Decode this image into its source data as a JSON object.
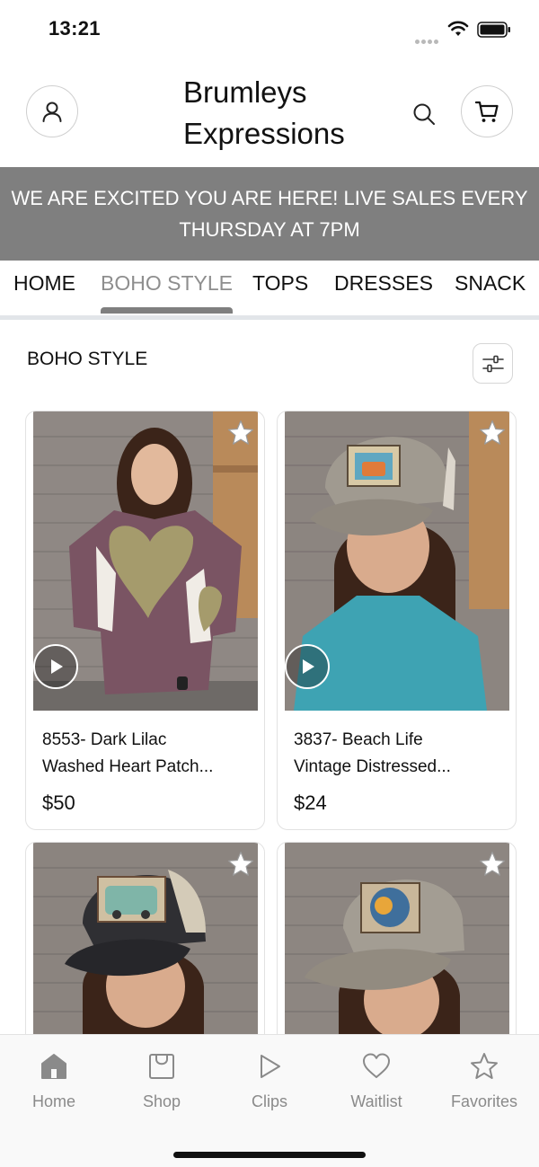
{
  "status_bar": {
    "time": "13:21"
  },
  "header": {
    "store_name": "Brumleys Expressions"
  },
  "banner": {
    "text": "WE ARE EXCITED YOU ARE HERE! LIVE SALES EVERY THURSDAY AT 7PM"
  },
  "categories": [
    {
      "label": "HOME",
      "active": false
    },
    {
      "label": "BOHO STYLE",
      "active": true
    },
    {
      "label": "TOPS",
      "active": false
    },
    {
      "label": "DRESSES",
      "active": false
    },
    {
      "label": "SNACK",
      "active": false
    }
  ],
  "section": {
    "title": "BOHO STYLE"
  },
  "products": [
    {
      "name_line1": "8553- Dark Lilac",
      "name_line2": "Washed Heart Patch...",
      "price": "$50",
      "has_video": true
    },
    {
      "name_line1": "3837- Beach Life",
      "name_line2": "Vintage Distressed...",
      "price": "$24",
      "has_video": true
    },
    {
      "name_line1": "",
      "name_line2": "",
      "price": "",
      "has_video": false
    },
    {
      "name_line1": "",
      "name_line2": "",
      "price": "",
      "has_video": false
    }
  ],
  "tab_bar": [
    {
      "label": "Home",
      "icon": "home-icon"
    },
    {
      "label": "Shop",
      "icon": "shop-icon"
    },
    {
      "label": "Clips",
      "icon": "play-icon"
    },
    {
      "label": "Waitlist",
      "icon": "heart-icon"
    },
    {
      "label": "Favorites",
      "icon": "star-icon"
    }
  ],
  "colors": {
    "banner_bg": "#7f7f7f",
    "active_tab": "#8e8e8e",
    "tab_inactive": "#8a8a8a"
  }
}
